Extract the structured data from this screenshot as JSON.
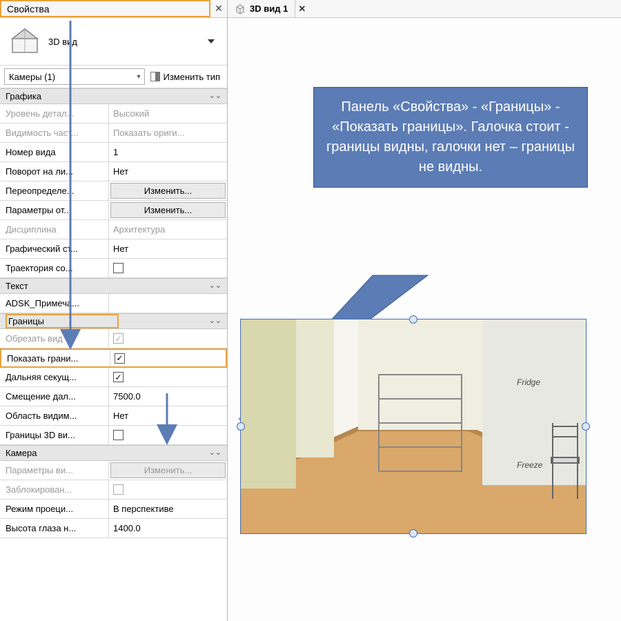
{
  "panel": {
    "title": "Свойства",
    "type_label": "3D вид",
    "instance": "Камеры (1)",
    "edit_type": "Изменить тип"
  },
  "sections": {
    "graphics": "Графика",
    "text": "Текст",
    "bounds": "Границы",
    "camera": "Камера"
  },
  "props": {
    "detail_level": {
      "label": "Уровень детал...",
      "value": "Высокий"
    },
    "visibility": {
      "label": "Видимость част...",
      "value": "Показать ориги..."
    },
    "view_num": {
      "label": "Номер вида",
      "value": "1"
    },
    "rotate_sheet": {
      "label": "Поворот на ли...",
      "value": "Нет"
    },
    "override": {
      "label": "Переопределе...",
      "value": "Изменить..."
    },
    "display_opt": {
      "label": "Параметры от...",
      "value": "Изменить..."
    },
    "discipline": {
      "label": "Дисциплина",
      "value": "Архитектура"
    },
    "graphic_style": {
      "label": "Графический ст...",
      "value": "Нет"
    },
    "sun_path": {
      "label": "Траектория со..."
    },
    "adsk_note": {
      "label": "ADSK_Примеча..."
    },
    "crop_view": {
      "label": "Обрезать вид"
    },
    "show_crop": {
      "label": "Показать грани..."
    },
    "far_clip": {
      "label": "Дальняя секущ..."
    },
    "far_offset": {
      "label": "Смещение дал...",
      "value": "7500.0"
    },
    "visibility_region": {
      "label": "Область видим...",
      "value": "Нет"
    },
    "bounds_3d": {
      "label": "Границы 3D ви..."
    },
    "view_params": {
      "label": "Параметры ви...",
      "value": "Изменить..."
    },
    "locked": {
      "label": "Заблокирован..."
    },
    "projection": {
      "label": "Режим проеци...",
      "value": "В перспективе"
    },
    "eye_height": {
      "label": "Высота глаза н...",
      "value": "1400.0"
    }
  },
  "tab": {
    "title": "3D вид 1"
  },
  "callout": {
    "text": "Панель «Свойства» - «Границы» - «Показать границы». Галочка стоит - границы видны, галочки нет – границы не видны."
  },
  "glyphs": {
    "check": "✓",
    "close": "✕",
    "collapse": "⌃"
  }
}
